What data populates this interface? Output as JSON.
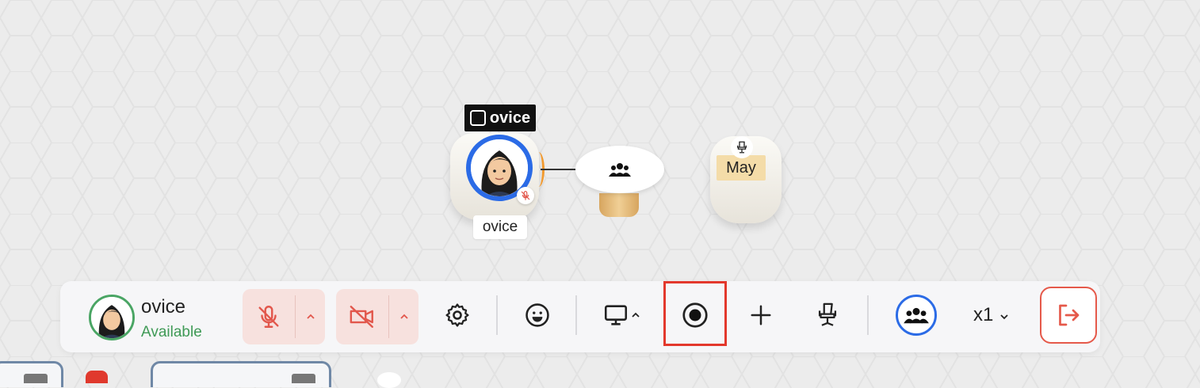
{
  "scene": {
    "brand_tag": "ovice",
    "avatar_name": "ovice",
    "seat_label": "May"
  },
  "toolbar": {
    "user_name": "ovice",
    "user_status": "Available",
    "speed_label": "x1",
    "icons": [
      "mic-off-icon",
      "camera-off-icon",
      "gear-icon",
      "emoji-icon",
      "monitor-icon",
      "record-icon",
      "plus-icon",
      "chair-icon",
      "group-icon",
      "leave-icon"
    ],
    "colors": {
      "muted_red": "#e2574c",
      "pill_bg": "#f7e1de",
      "status_green": "#3f9a56",
      "accent_blue": "#2b6be6",
      "highlight": "#e3382c"
    }
  }
}
